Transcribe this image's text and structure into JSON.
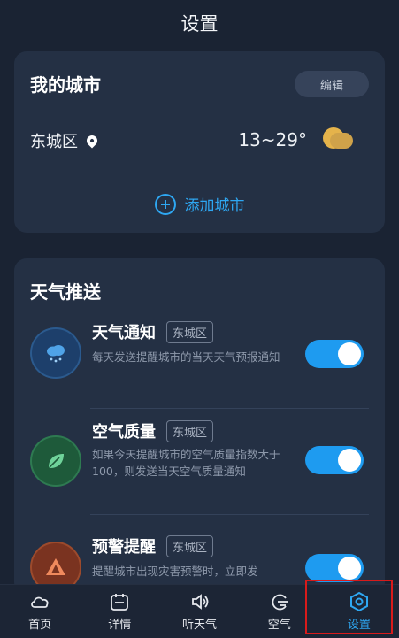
{
  "header": {
    "title": "设置"
  },
  "city_card": {
    "title": "我的城市",
    "edit_label": "编辑",
    "city": {
      "name": "东城区",
      "temp_range": "13~29°"
    },
    "add_label": "添加城市"
  },
  "push_card": {
    "title": "天气推送",
    "items": [
      {
        "title": "天气通知",
        "region": "东城区",
        "desc": "每天发送提醒城市的当天天气预报通知",
        "enabled": true,
        "icon": "rain-cloud-icon"
      },
      {
        "title": "空气质量",
        "region": "东城区",
        "desc": "如果今天提醒城市的空气质量指数大于100，则发送当天空气质量通知",
        "enabled": true,
        "icon": "leaf-icon"
      },
      {
        "title": "预警提醒",
        "region": "东城区",
        "desc": "提醒城市出现灾害预警时，立即发",
        "enabled": true,
        "icon": "warning-triangle-icon"
      }
    ]
  },
  "tabbar": {
    "tabs": [
      {
        "label": "首页",
        "icon": "cloud-icon"
      },
      {
        "label": "详情",
        "icon": "calendar-icon"
      },
      {
        "label": "听天气",
        "icon": "speaker-icon"
      },
      {
        "label": "空气",
        "icon": "wind-icon"
      },
      {
        "label": "设置",
        "icon": "settings-hexagon-icon",
        "active": true
      }
    ]
  },
  "colors": {
    "accent": "#2ea7f2",
    "background": "#1a2333",
    "card": "#243044",
    "toggle_on": "#1e9bf0"
  }
}
